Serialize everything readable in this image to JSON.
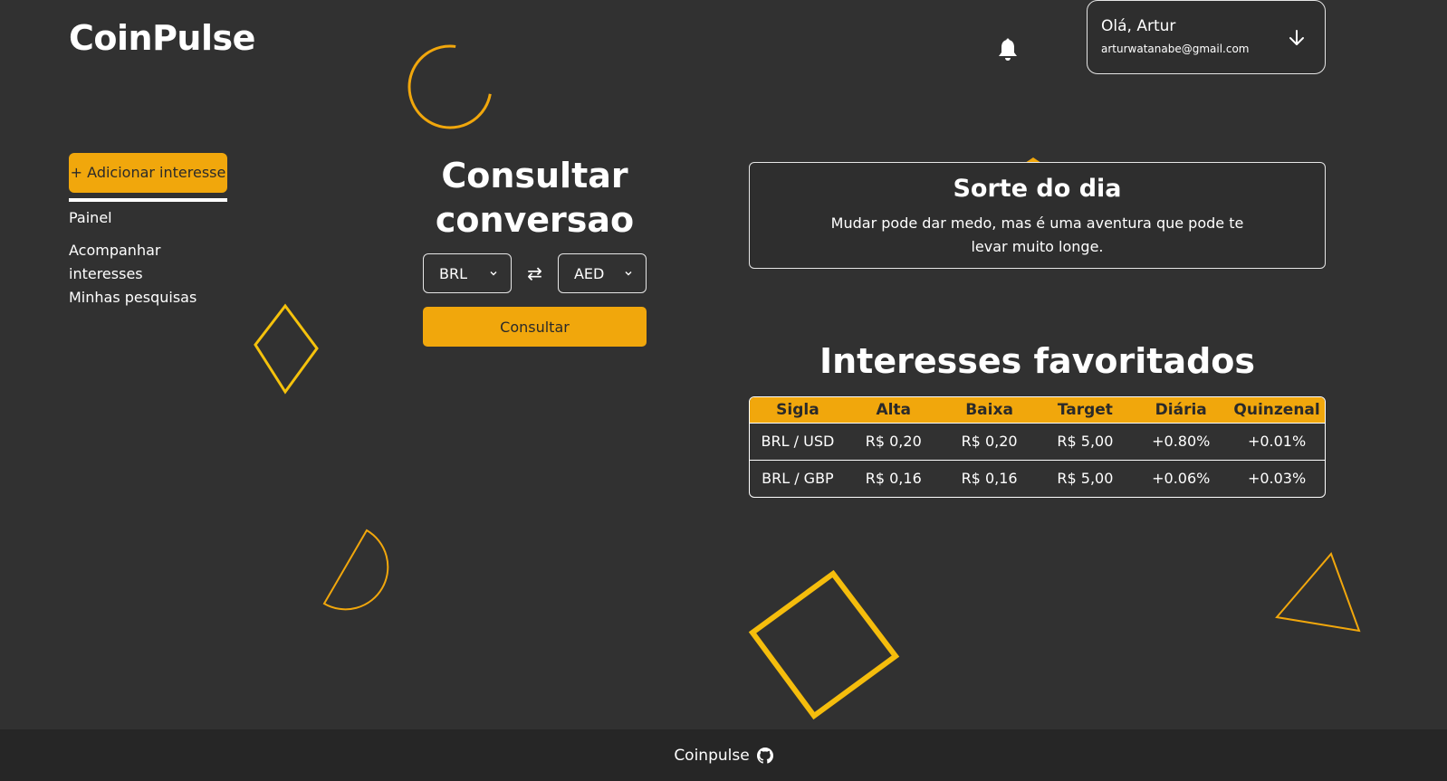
{
  "brand": {
    "name": "CoinPulse"
  },
  "sidebar": {
    "add_label": "+ Adicionar interesse",
    "items": [
      {
        "label": "Painel"
      },
      {
        "label": "Acompanhar interesses"
      },
      {
        "label": "Minhas pesquisas"
      }
    ]
  },
  "converter": {
    "title": "Consultar conversao",
    "from": "BRL",
    "to": "AED",
    "swap_glyph": "⇄",
    "button": "Consultar"
  },
  "header": {
    "user": {
      "greeting": "Olá, Artur",
      "email": "arturwatanabe@gmail.com"
    }
  },
  "fortune": {
    "title": "Sorte do dia",
    "text": "Mudar pode dar medo, mas é uma aventura que pode te levar muito longe."
  },
  "favorites": {
    "title": "Interesses favoritados",
    "columns": [
      "Sigla",
      "Alta",
      "Baixa",
      "Target",
      "Diária",
      "Quinzenal"
    ],
    "rows": [
      [
        "BRL / USD",
        "R$ 0,20",
        "R$ 0,20",
        "R$ 5,00",
        "+0.80%",
        "+0.01%"
      ],
      [
        "BRL / GBP",
        "R$ 0,16",
        "R$ 0,16",
        "R$ 5,00",
        "+0.06%",
        "+0.03%"
      ]
    ]
  },
  "footer": {
    "label": "Coinpulse"
  },
  "colors": {
    "accent": "#f1a70c",
    "background": "#313131",
    "footer": "#262626"
  }
}
